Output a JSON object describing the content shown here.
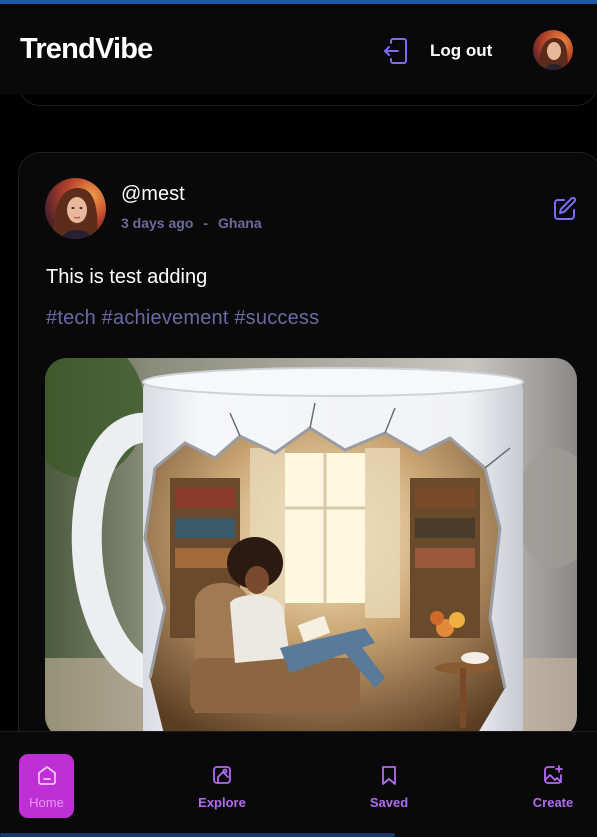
{
  "header": {
    "brand": "TrendVibe",
    "logout_label": "Log out",
    "logout_icon": "logout-icon",
    "avatar": "user-avatar"
  },
  "post": {
    "username": "@mest",
    "time": "3 days ago",
    "separator": "-",
    "location": "Ghana",
    "caption": "This is test adding",
    "tags": "#tech #achievement #success",
    "edit_icon": "edit-icon",
    "image": "mug-woman-reading-image"
  },
  "nav": {
    "items": [
      {
        "label": "Home",
        "icon": "home-icon",
        "active": true
      },
      {
        "label": "Explore",
        "icon": "explore-icon",
        "active": false
      },
      {
        "label": "Saved",
        "icon": "bookmark-icon",
        "active": false
      },
      {
        "label": "Create",
        "icon": "create-image-icon",
        "active": false
      }
    ]
  },
  "colors": {
    "accent": "#8b5cf6",
    "nav_active_bg": "#bf2fd6",
    "nav_label": "#b36bf0",
    "meta_text": "#6b6b9a",
    "tags_text": "#6a6aa4"
  }
}
